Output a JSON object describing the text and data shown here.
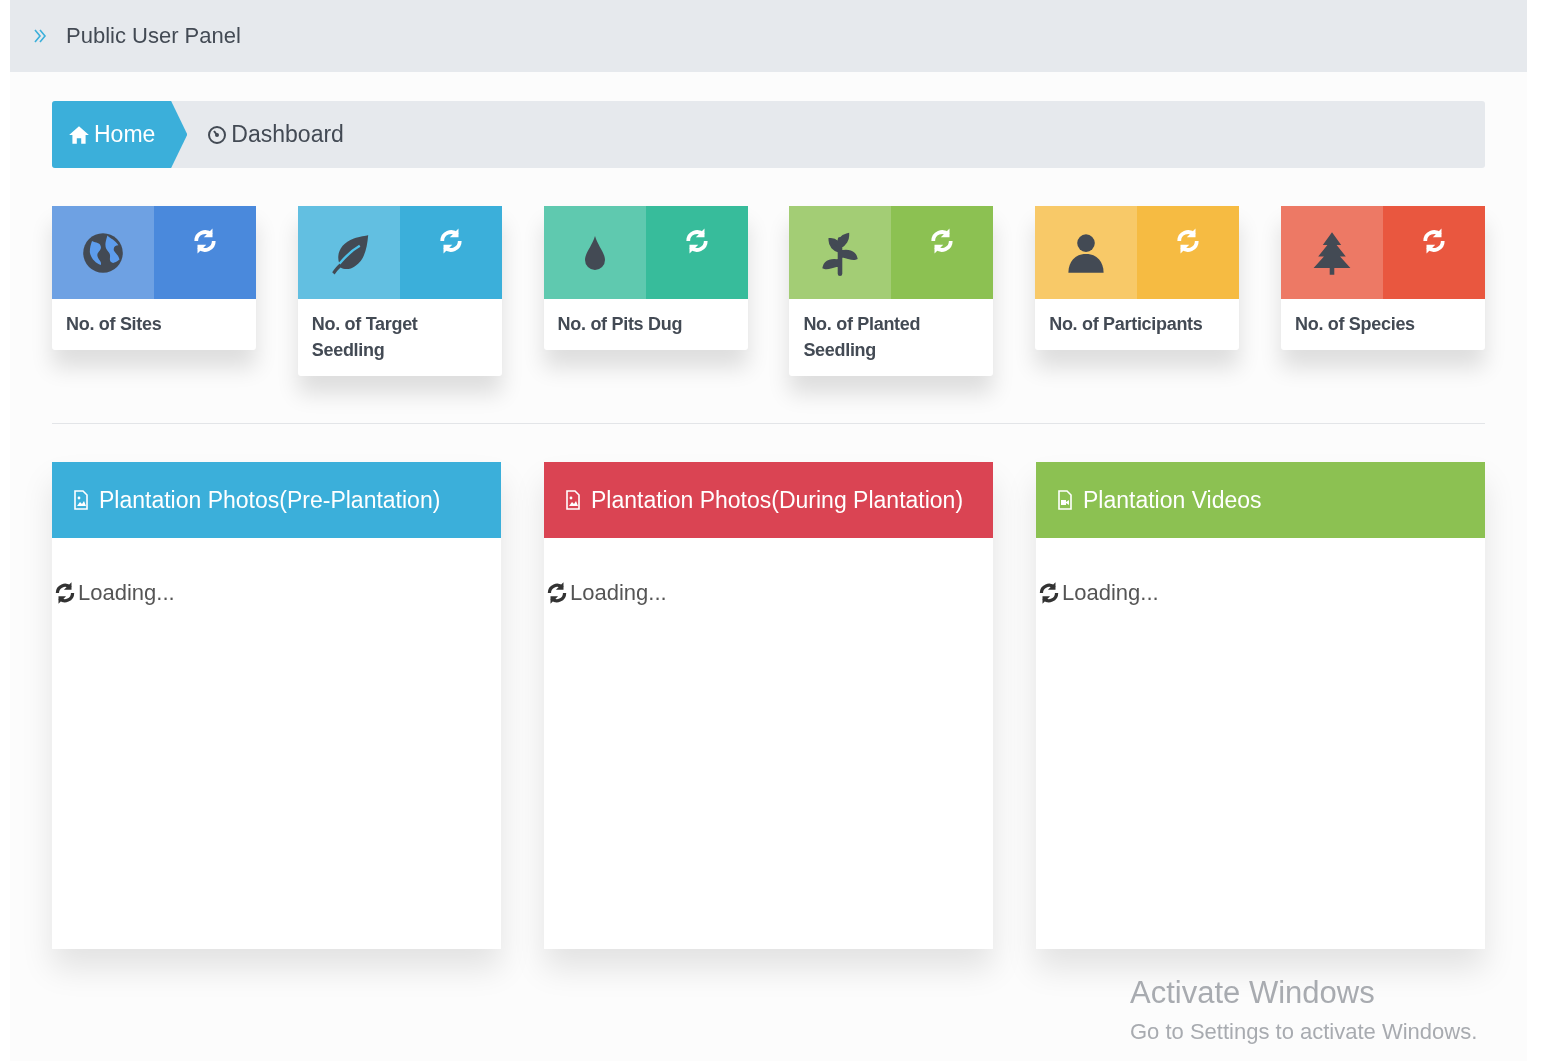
{
  "header": {
    "title": "Public User Panel"
  },
  "breadcrumb": [
    {
      "label": "Home",
      "kind": "home",
      "selected": true
    },
    {
      "label": "Dashboard",
      "kind": "gauge",
      "selected": false
    }
  ],
  "stats": [
    {
      "label": "No. of Sites",
      "kind": "globe",
      "color": "#4a89dc"
    },
    {
      "label": "No. of Target Seedling",
      "kind": "leaf",
      "color": "#3bafda"
    },
    {
      "label": "No. of Pits Dug",
      "kind": "drop",
      "color": "#37bc9b"
    },
    {
      "label": "No. of Planted Seedling",
      "kind": "sprout",
      "color": "#8cc152"
    },
    {
      "label": "No. of Participants",
      "kind": "user",
      "color": "#f6bb42"
    },
    {
      "label": "No. of Species",
      "kind": "tree",
      "color": "#e9573f"
    }
  ],
  "panels": [
    {
      "title": "Plantation Photos(Pre-Plantation)",
      "kind": "image",
      "color": "#3bafda",
      "status": "Loading..."
    },
    {
      "title": "Plantation Photos(During Plantation)",
      "kind": "image",
      "color": "#da4453",
      "status": "Loading..."
    },
    {
      "title": "Plantation Videos",
      "kind": "video",
      "color": "#8cc152",
      "status": "Loading..."
    }
  ],
  "windows_activation": {
    "title": "Activate Windows",
    "message": "Go to Settings to activate Windows."
  }
}
